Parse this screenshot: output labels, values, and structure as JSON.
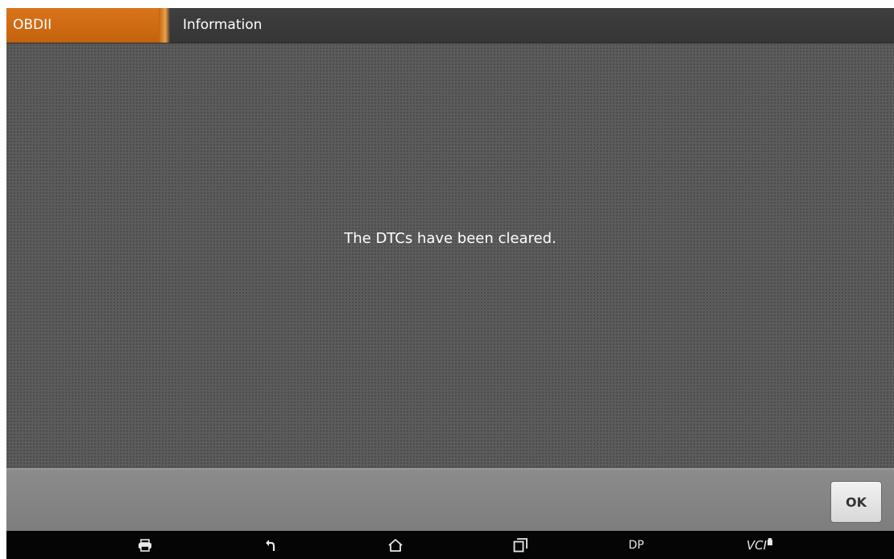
{
  "header": {
    "module_label": "OBDII",
    "page_title": "Information"
  },
  "content": {
    "message": "The DTCs have been cleared."
  },
  "actions": {
    "ok_label": "OK"
  },
  "navbar": {
    "items": [
      {
        "id": "print",
        "icon": "printer-icon"
      },
      {
        "id": "back",
        "icon": "back-arrow-icon"
      },
      {
        "id": "home",
        "icon": "home-icon"
      },
      {
        "id": "recent",
        "icon": "recent-apps-icon"
      },
      {
        "id": "dp",
        "label": "DP"
      },
      {
        "id": "vci",
        "label": "VCI",
        "icon": "vci-connection-icon"
      }
    ]
  },
  "colors": {
    "accent": "#cc6a12",
    "titlebar": "#3a3a3a",
    "content_bg": "#5c5c5c",
    "actionbar": "#858585",
    "navbar": "#050505"
  }
}
